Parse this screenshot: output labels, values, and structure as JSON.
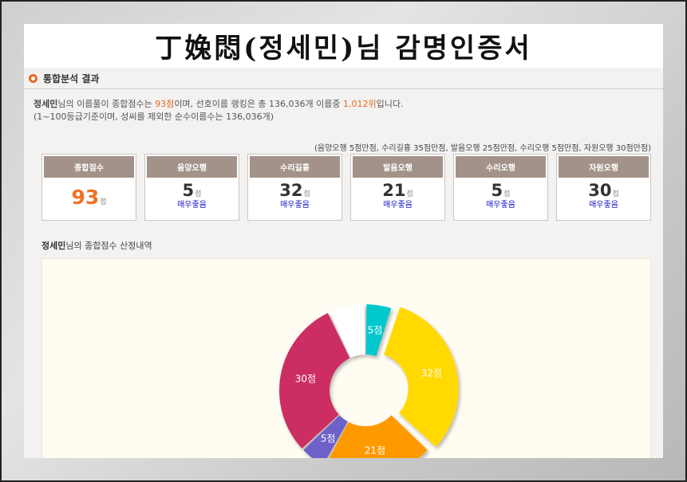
{
  "header": {
    "title": "丁婏悶(정세민)님 감명인증서"
  },
  "section": {
    "title": "통합분석 결과"
  },
  "summary": {
    "name": "정세민",
    "line1_a": "님의 이름풀이 종합점수는 ",
    "score_text": "93점",
    "line1_b": "이며, 선호이름 랭킹은 총 136,036개 이름중 ",
    "rank_text": "1,012위",
    "line1_c": "입니다.",
    "line2": "(1~100등급기준이며, 성씨를 제외한 순수이름수는 136,036개)"
  },
  "criteria": "(음양오행 5점만점, 수리길흉 35점만점, 발음오행 25점만점, 수리오행 5점만점, 자원오행 30점만점)",
  "boxes": [
    {
      "label": "종합점수",
      "value": "93",
      "unit": "점",
      "grade": ""
    },
    {
      "label": "음양오행",
      "value": "5",
      "unit": "점",
      "grade": "매우좋음"
    },
    {
      "label": "수리길흉",
      "value": "32",
      "unit": "점",
      "grade": "매우좋음"
    },
    {
      "label": "발음오행",
      "value": "21",
      "unit": "점",
      "grade": "매우좋음"
    },
    {
      "label": "수리오행",
      "value": "5",
      "unit": "점",
      "grade": "매우좋음"
    },
    {
      "label": "자원오행",
      "value": "30",
      "unit": "점",
      "grade": "매우좋음"
    }
  ],
  "breakdown": {
    "name": "정세민",
    "label": "님의 종합점수 산정내역"
  },
  "chart_data": {
    "type": "pie",
    "categories": [
      "음양오행",
      "수리길흉",
      "발음오행",
      "수리오행",
      "자원오행",
      ""
    ],
    "values": [
      5,
      32,
      21,
      5,
      30,
      7
    ],
    "labels": [
      "5점",
      "32점",
      "21점",
      "5점",
      "30점",
      ""
    ],
    "colors": [
      "#00c8cc",
      "#ffd900",
      "#ff9900",
      "#6e62c8",
      "#cc2f63",
      "#ffffff"
    ],
    "donut": true
  }
}
